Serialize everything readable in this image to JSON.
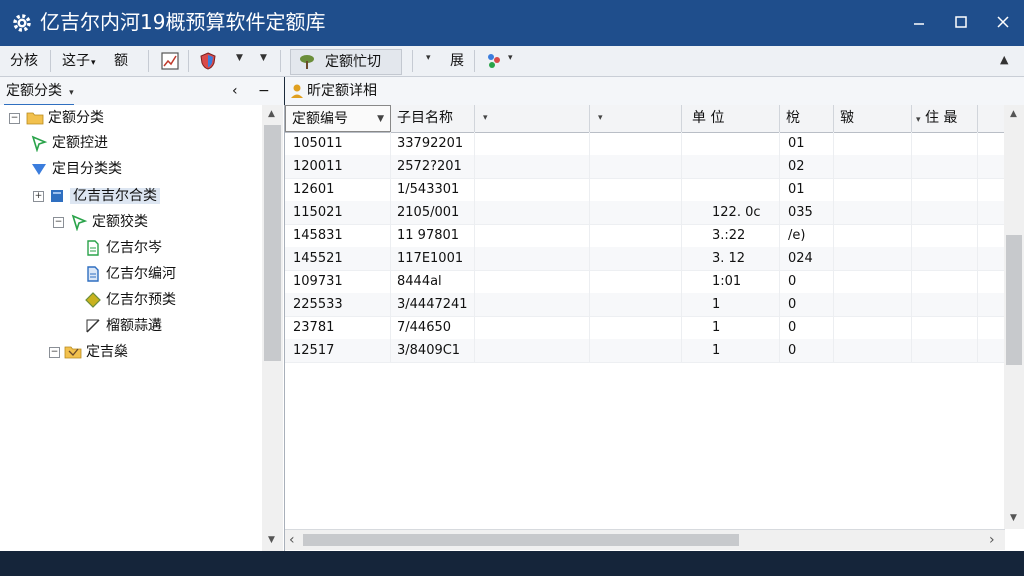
{
  "window": {
    "title": "亿吉尔内河19概预算软件定额库",
    "icons": {
      "app": "gear-icon",
      "minimize": "minimize-icon",
      "maximize": "maximize-icon",
      "close": "close-icon"
    }
  },
  "toolbar": {
    "menu1": "分核",
    "menu2": "这子",
    "menu3": "额",
    "quota_cut_label": "定额忙切",
    "expand_label": "展"
  },
  "left_panel": {
    "header_label": "定额分类",
    "tree": [
      {
        "label": "定额分类"
      },
      {
        "label": "定额控进"
      },
      {
        "label": "定目分类类"
      },
      {
        "label": "亿吉吉尔合类"
      },
      {
        "label": "定额狡类"
      },
      {
        "label": "亿吉尔岑"
      },
      {
        "label": "亿吉尔编河"
      },
      {
        "label": "亿吉尔预类"
      },
      {
        "label": "榴额蒜遘"
      },
      {
        "label": "定吉燊"
      }
    ]
  },
  "right_panel": {
    "header_label": "昕定额详相",
    "columns": [
      "定额编号",
      "子目名称",
      "",
      "",
      "单  位",
      "梲",
      "皲",
      "住 最"
    ],
    "rows": [
      [
        "105011",
        "33792201",
        "",
        "",
        "",
        "01",
        "",
        ""
      ],
      [
        "120011",
        "2572?201",
        "",
        "",
        "",
        "02",
        "",
        ""
      ],
      [
        "12601",
        "1/543301",
        "",
        "",
        "",
        "01",
        "",
        ""
      ],
      [
        "115021",
        "2105/001",
        "",
        "",
        "122. 0c",
        "035",
        "",
        ""
      ],
      [
        "145831",
        "11 97801",
        "",
        "",
        "3.:22",
        "/e)",
        "",
        ""
      ],
      [
        "145521",
        "117E1001",
        "",
        "",
        "3. 12",
        "024",
        "",
        ""
      ],
      [
        "109731",
        "8444al",
        "",
        "",
        "1:01",
        "0",
        "",
        ""
      ],
      [
        "225533",
        "3/4447241",
        "",
        "",
        "1",
        "0",
        "",
        ""
      ],
      [
        "23781",
        "7/44650",
        "",
        "",
        "1",
        "0",
        "",
        ""
      ],
      [
        "12517",
        "3/8409C1",
        "",
        "",
        "1",
        "0",
        "",
        ""
      ]
    ]
  },
  "colors": {
    "titlebar": "#1f4e8c",
    "selection": "#dde6f2",
    "folder": "#f2c14e",
    "accent_blue": "#2f6fc0"
  }
}
